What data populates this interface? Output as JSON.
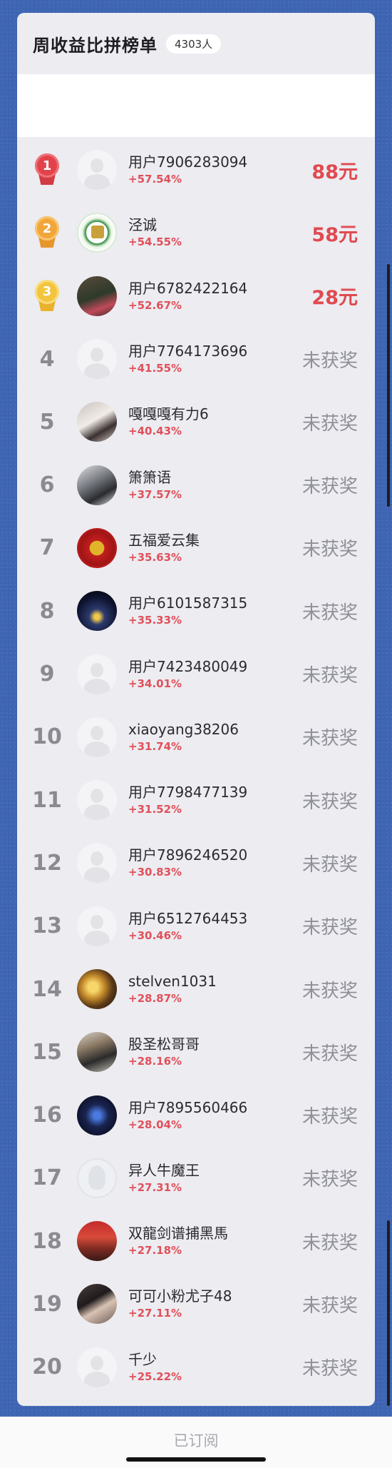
{
  "header": {
    "title": "周收益比拼榜单",
    "participants": "4303人"
  },
  "footer": {
    "subscribed_label": "已订阅"
  },
  "rows": [
    {
      "rank": "1",
      "avatar": "default",
      "name": "用户7906283094",
      "gain": "+57.54%",
      "prize": "88元"
    },
    {
      "rank": "2",
      "avatar": "emblem",
      "name": "泾诚",
      "gain": "+54.55%",
      "prize": "58元"
    },
    {
      "rank": "3",
      "avatar": "woman-photo",
      "name": "用户6782422164",
      "gain": "+52.67%",
      "prize": "28元"
    },
    {
      "rank": "4",
      "avatar": "default",
      "name": "用户7764173696",
      "gain": "+41.55%",
      "prize": "未获奖"
    },
    {
      "rank": "5",
      "avatar": "woman-photo",
      "name": "嘎嘎嘎有力6",
      "gain": "+40.43%",
      "prize": "未获奖"
    },
    {
      "rank": "6",
      "avatar": "man-photo",
      "name": "箫箫语",
      "gain": "+37.57%",
      "prize": "未获奖"
    },
    {
      "rank": "7",
      "avatar": "fu-character",
      "name": "五福爱云集",
      "gain": "+35.63%",
      "prize": "未获奖"
    },
    {
      "rank": "8",
      "avatar": "night-building",
      "name": "用户6101587315",
      "gain": "+35.33%",
      "prize": "未获奖"
    },
    {
      "rank": "9",
      "avatar": "default",
      "name": "用户7423480049",
      "gain": "+34.01%",
      "prize": "未获奖"
    },
    {
      "rank": "10",
      "avatar": "default",
      "name": "xiaoyang38206",
      "gain": "+31.74%",
      "prize": "未获奖"
    },
    {
      "rank": "11",
      "avatar": "default",
      "name": "用户7798477139",
      "gain": "+31.52%",
      "prize": "未获奖"
    },
    {
      "rank": "12",
      "avatar": "default",
      "name": "用户7896246520",
      "gain": "+30.83%",
      "prize": "未获奖"
    },
    {
      "rank": "13",
      "avatar": "default",
      "name": "用户6512764453",
      "gain": "+30.46%",
      "prize": "未获奖"
    },
    {
      "rank": "14",
      "avatar": "tea",
      "name": "stelven1031",
      "gain": "+28.87%",
      "prize": "未获奖"
    },
    {
      "rank": "15",
      "avatar": "man-photo",
      "name": "股圣松哥哥",
      "gain": "+28.16%",
      "prize": "未获奖"
    },
    {
      "rank": "16",
      "avatar": "card",
      "name": "用户7895560466",
      "gain": "+28.04%",
      "prize": "未获奖"
    },
    {
      "rank": "17",
      "avatar": "ghost",
      "name": "异人牛魔王",
      "gain": "+27.31%",
      "prize": "未获奖"
    },
    {
      "rank": "18",
      "avatar": "man-red",
      "name": "双龍剑谱捕黑馬",
      "gain": "+27.18%",
      "prize": "未获奖"
    },
    {
      "rank": "19",
      "avatar": "girl-photo",
      "name": "可可小粉尤子48",
      "gain": "+27.11%",
      "prize": "未获奖"
    },
    {
      "rank": "20",
      "avatar": "default",
      "name": "千少",
      "gain": "+25.22%",
      "prize": "未获奖"
    }
  ],
  "colors": {
    "background": "#3f66b4",
    "panel": "#ececf1",
    "gain": "#e0505a",
    "prize_won": "#e04a50",
    "prize_none": "#8f9098"
  }
}
